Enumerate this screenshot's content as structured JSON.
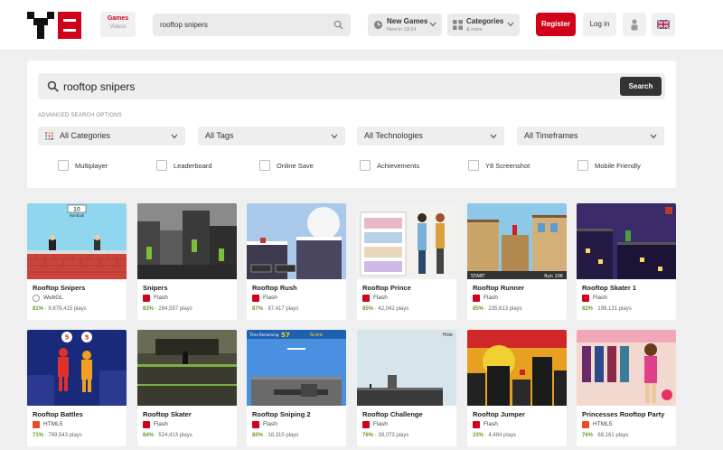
{
  "header": {
    "games_tab": {
      "label": "Games",
      "sublabel": "Videos"
    },
    "search": {
      "value": "rooftop snipers"
    },
    "new_games": {
      "label": "New Games",
      "sublabel": "Next in 19:24"
    },
    "categories": {
      "label": "Categories",
      "sublabel": "& more"
    },
    "register_label": "Register",
    "login_label": "Log in"
  },
  "search_panel": {
    "query": "rooftop snipers",
    "search_button": "Search",
    "advanced_label": "ADVANCED SEARCH OPTIONS",
    "dropdowns": [
      "All Categories",
      "All Tags",
      "All Technologies",
      "All Timeframes"
    ],
    "checkboxes": [
      "Multiplayer",
      "Leaderboard",
      "Online Save",
      "Achievements",
      "Y8 Screenshot",
      "Mobile Friendly"
    ]
  },
  "games": [
    {
      "title": "Rooftop Snipers",
      "tech": "WebGL",
      "rating": "81%",
      "plays": "9,879,415 plays"
    },
    {
      "title": "Snipers",
      "tech": "Flash",
      "rating": "83%",
      "plays": "284,597 plays"
    },
    {
      "title": "Rooftop Rush",
      "tech": "Flash",
      "rating": "87%",
      "plays": "87,417 plays"
    },
    {
      "title": "Rooftop Prince",
      "tech": "Flash",
      "rating": "85%",
      "plays": "42,042 plays"
    },
    {
      "title": "Rooftop Runner",
      "tech": "Flash",
      "rating": "85%",
      "plays": "235,613 plays"
    },
    {
      "title": "Rooftop Skater 1",
      "tech": "Flash",
      "rating": "82%",
      "plays": "199,131 plays"
    },
    {
      "title": "Rooftop Battles",
      "tech": "HTML5",
      "rating": "71%",
      "plays": "789,543 plays"
    },
    {
      "title": "Rooftop Skater",
      "tech": "Flash",
      "rating": "84%",
      "plays": "524,413 plays"
    },
    {
      "title": "Rooftop Sniping 2",
      "tech": "Flash",
      "rating": "80%",
      "plays": "18,315 plays"
    },
    {
      "title": "Rooftop Challenge",
      "tech": "Flash",
      "rating": "76%",
      "plays": "39,073 plays"
    },
    {
      "title": "Rooftop Jumper",
      "tech": "Flash",
      "rating": "33%",
      "plays": "4,484 plays"
    },
    {
      "title": "Princesses Rooftop Party",
      "tech": "HTML5",
      "rating": "76%",
      "plays": "68,161 plays"
    }
  ],
  "thumb_text": {
    "t1_hud": "10",
    "t1_sub": "Hardball",
    "t5_start": "START",
    "t5_run": "Run 106",
    "t7_a": "5",
    "t7_b": "5",
    "t9_time": "Time Remaining",
    "t9_score": "Score",
    "t9_num": "57",
    "t10_tag": "Hide"
  },
  "colors": {
    "brand": "#d0021b",
    "rating": "#6a9b2a",
    "flash": "#d0021b",
    "html5": "#e44d26"
  }
}
